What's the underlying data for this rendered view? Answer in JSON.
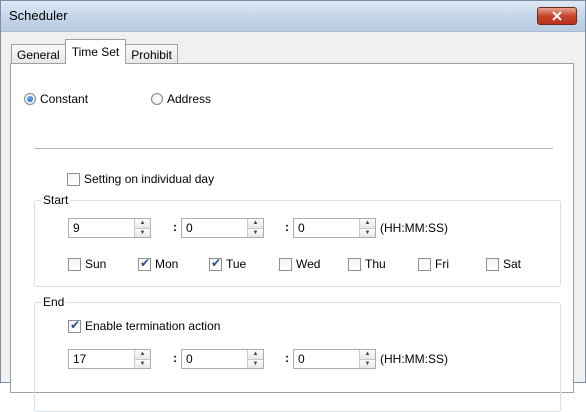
{
  "window": {
    "title": "Scheduler",
    "close_icon": "close-icon"
  },
  "tabs": [
    {
      "label": "General"
    },
    {
      "label": "Time Set"
    },
    {
      "label": "Prohibit"
    }
  ],
  "mode": {
    "constant_label": "Constant",
    "address_label": "Address",
    "selected": "Constant"
  },
  "individual_day": {
    "label": "Setting on individual day",
    "checked": false
  },
  "start": {
    "group_label": "Start",
    "hour": "9",
    "minute": "0",
    "second": "0",
    "colon": ":",
    "format_label": "(HH:MM:SS)",
    "days": [
      {
        "label": "Sun",
        "checked": false
      },
      {
        "label": "Mon",
        "checked": true
      },
      {
        "label": "Tue",
        "checked": true
      },
      {
        "label": "Wed",
        "checked": false
      },
      {
        "label": "Thu",
        "checked": false
      },
      {
        "label": "Fri",
        "checked": false
      },
      {
        "label": "Sat",
        "checked": false
      }
    ]
  },
  "end": {
    "group_label": "End",
    "termination_label": "Enable termination action",
    "termination_checked": true,
    "hour": "17",
    "minute": "0",
    "second": "0",
    "colon": ":",
    "format_label": "(HH:MM:SS)"
  },
  "spinner": {
    "up_glyph": "▲",
    "down_glyph": "▼"
  }
}
